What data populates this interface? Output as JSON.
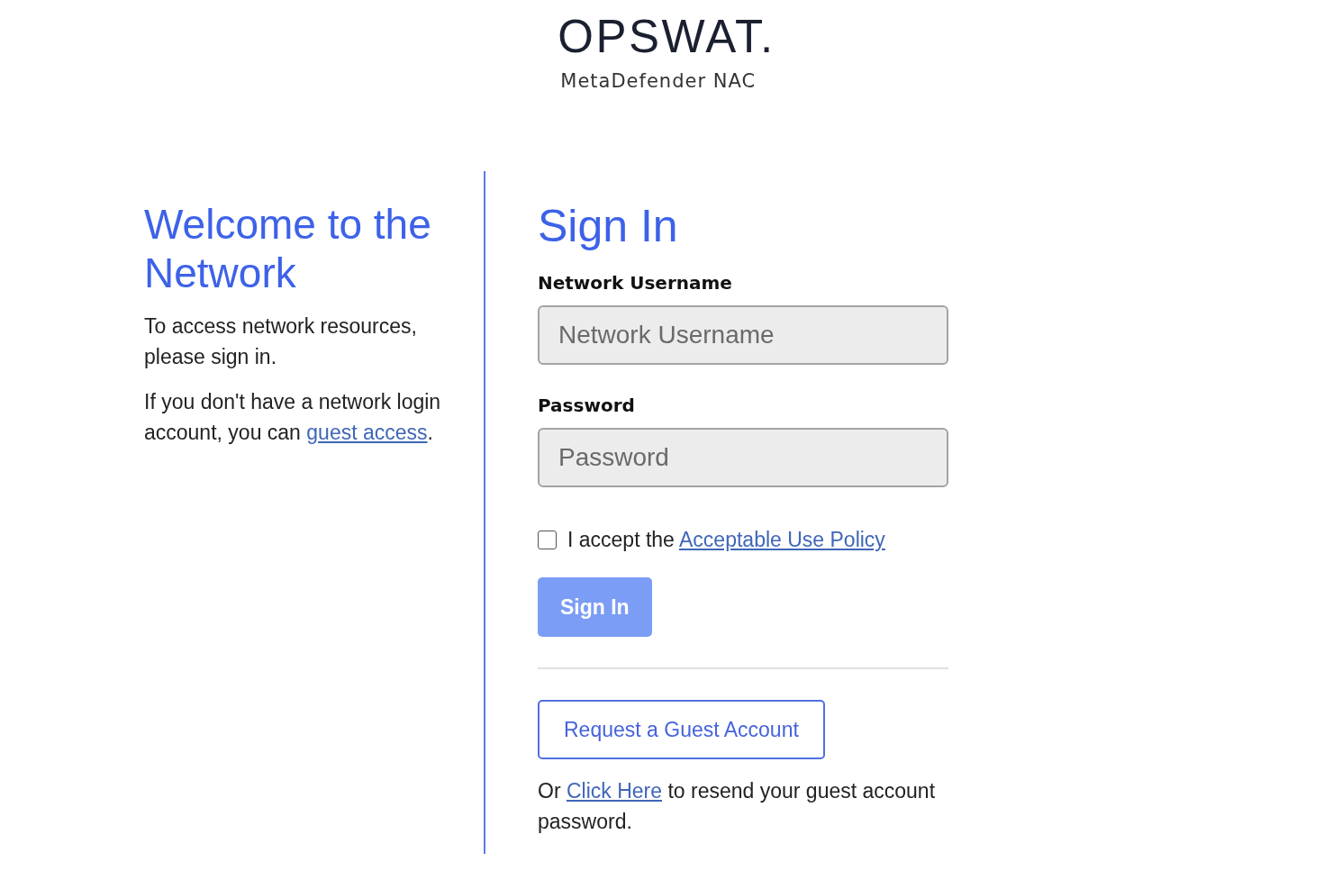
{
  "logo": {
    "wordmark": "OPSWAT.",
    "product": "MetaDefender NAC"
  },
  "welcome": {
    "title": "Welcome to the Network",
    "paragraphs": [
      {
        "parts": [
          {
            "kind": "text",
            "text": "To access network resources, please sign in."
          }
        ]
      },
      {
        "parts": [
          {
            "kind": "text",
            "text": "If you don't have a network login account, you can "
          },
          {
            "kind": "link",
            "text": "guest access"
          },
          {
            "kind": "text",
            "text": "."
          }
        ]
      }
    ]
  },
  "sign_in": {
    "title": "Sign In",
    "fields": [
      {
        "label": "Network Username",
        "placeholder": "Network Username"
      },
      {
        "label": "Password",
        "placeholder": "Password"
      }
    ],
    "policy": {
      "checked": false,
      "parts": [
        {
          "kind": "text",
          "text": "I accept the "
        },
        {
          "kind": "link",
          "text": "Acceptable Use Policy"
        }
      ]
    },
    "submit": {
      "label": "Sign In",
      "disabled": true
    },
    "guest_button": {
      "label": "Request a Guest Account"
    },
    "resend_note": {
      "parts": [
        {
          "kind": "text",
          "text": "Or "
        },
        {
          "kind": "link",
          "text": "Click Here"
        },
        {
          "kind": "text",
          "text": " to resend your guest account password."
        }
      ]
    }
  }
}
